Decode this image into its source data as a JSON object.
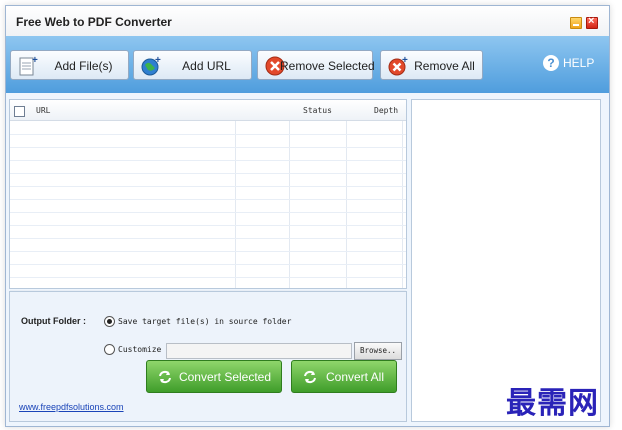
{
  "window": {
    "title": "Free Web to PDF Converter"
  },
  "toolbar": {
    "add_files_label": "Add File(s)",
    "add_url_label": "Add URL",
    "remove_selected_label": "Remove Selected",
    "remove_all_label": "Remove All",
    "help_label": "HELP"
  },
  "table": {
    "columns": [
      "URL",
      "Status",
      "Depth"
    ],
    "rows": []
  },
  "output": {
    "label": "Output Folder :",
    "option_source": "Save target file(s) in source folder",
    "option_customize": "Customize",
    "selected_option": "source",
    "custom_path": "",
    "browse_label": "Browse..",
    "convert_selected_label": "Convert Selected",
    "convert_all_label": "Convert All",
    "website_link": "www.freepdfsolutions.com"
  },
  "watermark": "最需网",
  "colors": {
    "toolbar_top": "#8ec6f0",
    "toolbar_bottom": "#4f9ddd",
    "convert_green": "#3f9d2a",
    "link_blue": "#1a44b8"
  },
  "icons": {
    "add_files": "document-add-icon",
    "add_url": "globe-add-icon",
    "remove_selected": "red-x-icon",
    "remove_all": "red-x-add-icon",
    "help": "question-circle-icon",
    "convert": "refresh-arrows-icon"
  }
}
